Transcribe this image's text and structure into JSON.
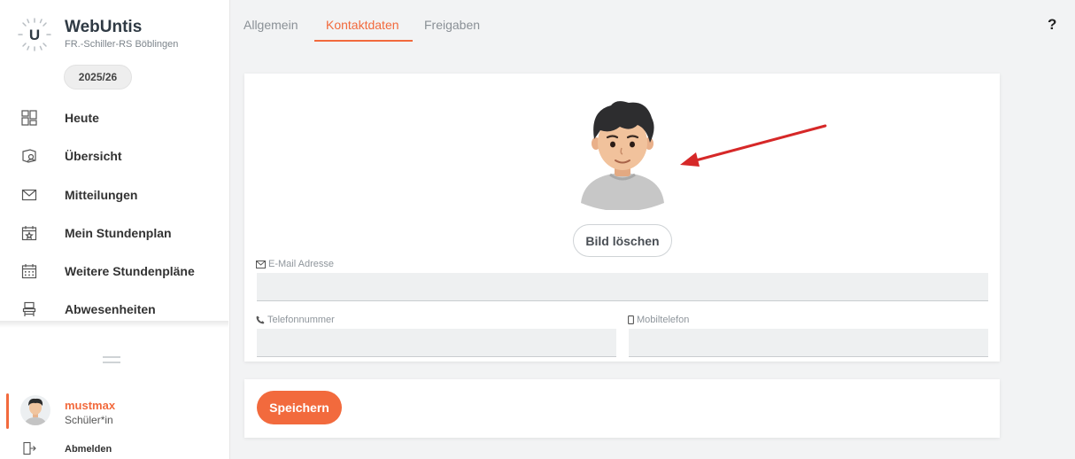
{
  "app": {
    "title": "WebUntis",
    "school": "FR.-Schiller-RS Böblingen",
    "school_year": "2025/26",
    "logo_letter": "U",
    "accent_color": "#f26a3d"
  },
  "sidebar": {
    "items": [
      {
        "label": "Heute",
        "icon": "dashboard-icon"
      },
      {
        "label": "Übersicht",
        "icon": "overview-icon"
      },
      {
        "label": "Mitteilungen",
        "icon": "mail-icon"
      },
      {
        "label": "Mein Stundenplan",
        "icon": "calendar-star-icon"
      },
      {
        "label": "Weitere Stundenpläne",
        "icon": "calendar-grid-icon"
      },
      {
        "label": "Abwesenheiten",
        "icon": "chair-icon"
      }
    ],
    "user": {
      "name": "mustmax",
      "role": "Schüler*in"
    },
    "logout_label": "Abmelden"
  },
  "tabs": [
    {
      "label": "Allgemein",
      "active": false
    },
    {
      "label": "Kontaktdaten",
      "active": true
    },
    {
      "label": "Freigaben",
      "active": false
    }
  ],
  "help_label": "?",
  "profile": {
    "delete_photo_label": "Bild löschen",
    "email": {
      "label": "E-Mail Adresse",
      "value": ""
    },
    "phone": {
      "label": "Telefonnummer",
      "value": ""
    },
    "mobile": {
      "label": "Mobiltelefon",
      "value": ""
    }
  },
  "save_label": "Speichern"
}
